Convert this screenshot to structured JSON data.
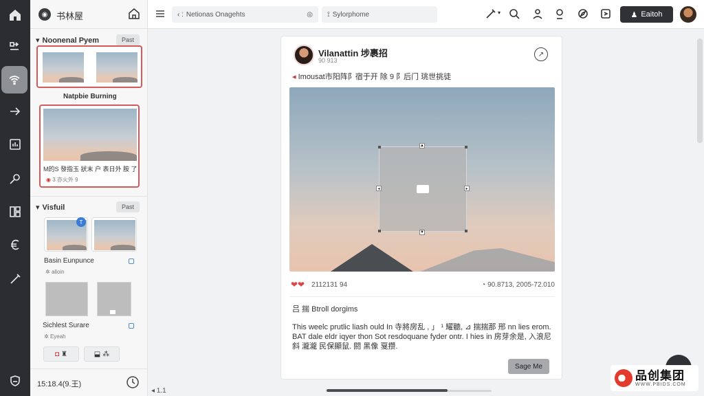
{
  "rail": {
    "icons": [
      "home-icon",
      "workflow-icon",
      "wireless-icon",
      "arrow-right-icon",
      "chart-icon",
      "wrench-icon",
      "dashboard-icon",
      "currency-icon",
      "pen-icon",
      "shield-icon"
    ]
  },
  "panel": {
    "title": "书林屋",
    "section1": {
      "title": "Noonenal Pyem",
      "button": "Past"
    },
    "card_selected_title": "Natpbie Burning",
    "card_selected_caption": "M的S  發指玉 狀末  户  表日外 胺 了",
    "card_selected_meta": "3 亦火外  9",
    "section2": {
      "title": "Visfuil",
      "button": "Past",
      "badge": "T"
    },
    "item1": {
      "title": "Basin Eunpunce",
      "sub": "alloin"
    },
    "item2": {
      "title": "Sichlest Surare",
      "sub": "Eyeah"
    },
    "clock": "15:18.4(9.王)"
  },
  "topbar": {
    "search1": "Netionas Onagehts",
    "search2": "Sylorphome",
    "cta": "Eaitoh"
  },
  "post": {
    "name": "Vilanattin 埗裹招",
    "sub": "90 913",
    "caption": "Imousat市阳阵阝宿于开 除 9 阝后门  珧世挑徒",
    "likes": "2112131 94",
    "views": "90.8713, 2005-72.010",
    "comment_head": "吕 揣 Btroll dorgims",
    "comment_body": "This weelc prutlic liash ould  In  寺將房乱 , 」 ¹ 耀聽, ⊿ 揣揣那 邢 nn lies erom. BAT dale eldr iqyer thon Sot resdoquane fyder ontr. I hies  in  房芽余是, 入浪尼斜 瀧瀧 民保顯鼠. 閼 黑像 戛攒.",
    "button": "Sage Me"
  },
  "footer": {
    "zoom": "◂ 1.1",
    "scroll_fraction": 0.73
  },
  "watermark": {
    "big": "品创集团",
    "small": "WWW.PBIDS.COM"
  }
}
